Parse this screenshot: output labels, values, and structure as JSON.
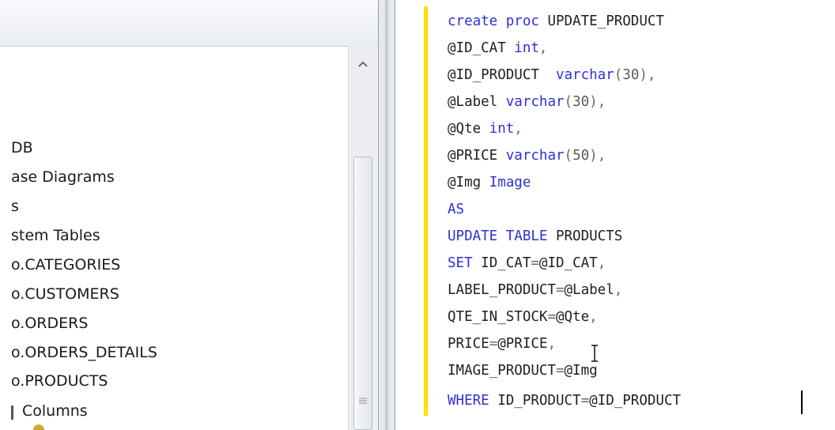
{
  "explorer": {
    "tree": [
      {
        "label": "DB"
      },
      {
        "label": "ase Diagrams"
      },
      {
        "label": "s"
      },
      {
        "label": "stem Tables"
      },
      {
        "label": "o.CATEGORIES"
      },
      {
        "label": "o.CUSTOMERS"
      },
      {
        "label": "o.ORDERS"
      },
      {
        "label": "o.ORDERS_DETAILS"
      },
      {
        "label": "o.PRODUCTS"
      },
      {
        "label": "Columns"
      }
    ]
  },
  "editor": {
    "lines": [
      [
        {
          "t": "kw",
          "v": "create proc "
        },
        {
          "t": "id",
          "v": "UPDATE_PRODUCT"
        }
      ],
      [
        {
          "t": "id",
          "v": "@ID_CAT "
        },
        {
          "t": "kw",
          "v": "int"
        },
        {
          "t": "pun",
          "v": ","
        }
      ],
      [
        {
          "t": "id",
          "v": "@ID_PRODUCT  "
        },
        {
          "t": "kw",
          "v": "varchar"
        },
        {
          "t": "pun",
          "v": "("
        },
        {
          "t": "num",
          "v": "30"
        },
        {
          "t": "pun",
          "v": "),"
        }
      ],
      [
        {
          "t": "id",
          "v": "@Label "
        },
        {
          "t": "kw",
          "v": "varchar"
        },
        {
          "t": "pun",
          "v": "("
        },
        {
          "t": "num",
          "v": "30"
        },
        {
          "t": "pun",
          "v": "),"
        }
      ],
      [
        {
          "t": "id",
          "v": "@Qte "
        },
        {
          "t": "kw",
          "v": "int"
        },
        {
          "t": "pun",
          "v": ","
        }
      ],
      [
        {
          "t": "id",
          "v": "@PRICE "
        },
        {
          "t": "kw",
          "v": "varchar"
        },
        {
          "t": "pun",
          "v": "("
        },
        {
          "t": "num",
          "v": "50"
        },
        {
          "t": "pun",
          "v": "),"
        }
      ],
      [
        {
          "t": "id",
          "v": "@Img "
        },
        {
          "t": "kw",
          "v": "Image"
        }
      ],
      [
        {
          "t": "kw",
          "v": "AS"
        }
      ],
      [
        {
          "t": "kw",
          "v": "UPDATE TABLE "
        },
        {
          "t": "id",
          "v": "PRODUCTS"
        }
      ],
      [
        {
          "t": "kw",
          "v": "SET "
        },
        {
          "t": "id",
          "v": "ID_CAT"
        },
        {
          "t": "pun",
          "v": "="
        },
        {
          "t": "id",
          "v": "@ID_CAT"
        },
        {
          "t": "pun",
          "v": ","
        }
      ],
      [
        {
          "t": "id",
          "v": "LABEL_PRODUCT"
        },
        {
          "t": "pun",
          "v": "="
        },
        {
          "t": "id",
          "v": "@Label"
        },
        {
          "t": "pun",
          "v": ","
        }
      ],
      [
        {
          "t": "id",
          "v": "QTE_IN_STOCK"
        },
        {
          "t": "pun",
          "v": "="
        },
        {
          "t": "id",
          "v": "@Qte"
        },
        {
          "t": "pun",
          "v": ","
        }
      ],
      [
        {
          "t": "id",
          "v": "PRICE"
        },
        {
          "t": "pun",
          "v": "="
        },
        {
          "t": "id",
          "v": "@PRICE"
        },
        {
          "t": "pun",
          "v": ","
        }
      ],
      [
        {
          "t": "id",
          "v": "IMAGE_PRODUCT"
        },
        {
          "t": "pun",
          "v": "="
        },
        {
          "t": "id",
          "v": "@Img"
        }
      ],
      [
        {
          "t": "kw",
          "v": "WHERE "
        },
        {
          "t": "id",
          "v": "ID_PRODUCT"
        },
        {
          "t": "pun",
          "v": "="
        },
        {
          "t": "id",
          "v": "@ID_PRODUCT"
        }
      ]
    ]
  },
  "colors": {
    "keyword": "#2f2fd6",
    "change_bar": "#ffe000",
    "selection": "#dfe8f3"
  },
  "icons": {
    "scroll_up": "chevron-up-icon",
    "grip": "grip-icon",
    "columns_folder": "folder-icon",
    "key": "key-icon"
  }
}
